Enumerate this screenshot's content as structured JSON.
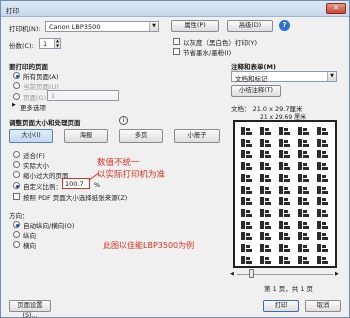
{
  "window": {
    "title": "打印"
  },
  "printer": {
    "label": "打印机(N):",
    "value": "Canon LBP3500",
    "properties_button": "属性(P)",
    "advanced_button": "高级(D)",
    "copies_label": "份数(C):",
    "copies_value": "1",
    "grayscale_label": "以灰度（黑白色）打印(Y)",
    "save_ink_label": "节省墨水/墨粉(I)"
  },
  "pages": {
    "heading": "要打印的页面",
    "all": "所有页面(A)",
    "current": "当前页面(U)",
    "range": "页面(G)",
    "range_value": "1",
    "more": "更多选项"
  },
  "sizing": {
    "heading": "调整页面大小和处理页面",
    "tabs": [
      "大小(I)",
      "海报",
      "多页",
      "小册子"
    ],
    "fit": "适合(F)",
    "actual": "实际大小",
    "shrink": "缩小过大的页面",
    "custom": "自定义比例：",
    "custom_value": "100.7",
    "percent": "%",
    "pdf_paper": "按照 PDF 页面大小选择纸张来源(Z)"
  },
  "orientation": {
    "heading": "方向：",
    "auto": "自动纵向/横向(O)",
    "portrait": "纵向",
    "landscape": "横向"
  },
  "annotations": {
    "heading": "注释和表单(M)",
    "value": "文档和标记",
    "summary_button": "小结注释(T)",
    "doc_size": "文档： 21.0 x 29.7厘米",
    "paper_size": "21 x 29.69 厘米",
    "page_indicator": "第 1 页，共 1 页"
  },
  "overlay": {
    "note_line1": "数值不统一",
    "note_line2": "以实际打印机为准",
    "example": "此图以佳能LBP3500为例"
  },
  "footer": {
    "page_setup": "页面设置(S)...",
    "print": "打印",
    "cancel": "取消"
  },
  "colors": {
    "accent_red": "#e0311f",
    "title_bar": "#c7d7ec"
  }
}
